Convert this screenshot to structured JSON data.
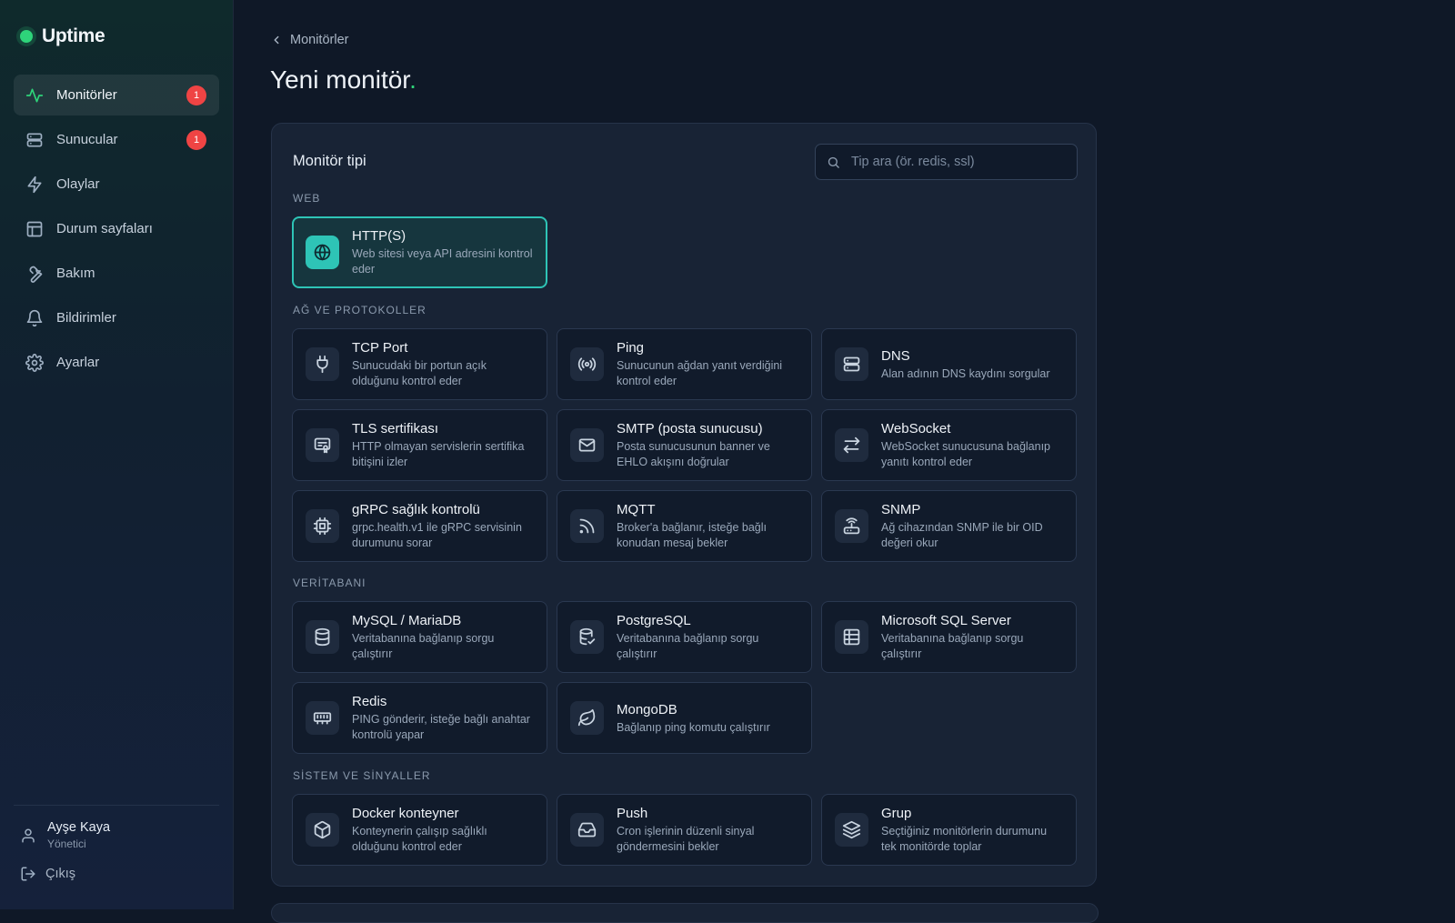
{
  "brand": {
    "name": "Uptime",
    "status_color": "#2ed47a"
  },
  "sidebar": {
    "items": [
      {
        "label": "Monitörler",
        "icon": "activity-icon",
        "badge": "1",
        "active": true
      },
      {
        "label": "Sunucular",
        "icon": "server-icon",
        "badge": "1"
      },
      {
        "label": "Olaylar",
        "icon": "zap-icon"
      },
      {
        "label": "Durum sayfaları",
        "icon": "layout-icon"
      },
      {
        "label": "Bakım",
        "icon": "wrench-icon"
      },
      {
        "label": "Bildirimler",
        "icon": "bell-icon"
      },
      {
        "label": "Ayarlar",
        "icon": "gear-icon"
      }
    ],
    "user": {
      "name": "Ayşe Kaya",
      "role": "Yönetici"
    },
    "logout_label": "Çıkış"
  },
  "header": {
    "breadcrumb": "Monitörler",
    "title": "Yeni monitör",
    "title_dot": "."
  },
  "panel": {
    "title": "Monitör tipi",
    "search_placeholder": "Tip ara (ör. redis, ssl)",
    "sections": [
      {
        "label": "WEB",
        "cards": [
          {
            "title": "HTTP(S)",
            "desc": "Web sitesi veya API adresini kontrol eder",
            "icon": "globe-icon",
            "selected": true
          }
        ]
      },
      {
        "label": "AĞ VE PROTOKOLLER",
        "cards": [
          {
            "title": "TCP Port",
            "desc": "Sunucudaki bir portun açık olduğunu kontrol eder",
            "icon": "plug-icon"
          },
          {
            "title": "Ping",
            "desc": "Sunucunun ağdan yanıt verdiğini kontrol eder",
            "icon": "radio-icon"
          },
          {
            "title": "DNS",
            "desc": "Alan adının DNS kaydını sorgular",
            "icon": "server-icon"
          },
          {
            "title": "TLS sertifikası",
            "desc": "HTTP olmayan servislerin sertifika bitişini izler",
            "icon": "certificate-icon"
          },
          {
            "title": "SMTP (posta sunucusu)",
            "desc": "Posta sunucusunun banner ve EHLO akışını doğrular",
            "icon": "mail-icon"
          },
          {
            "title": "WebSocket",
            "desc": "WebSocket sunucusuna bağlanıp yanıtı kontrol eder",
            "icon": "arrows-icon"
          },
          {
            "title": "gRPC sağlık kontrolü",
            "desc": "grpc.health.v1 ile gRPC servisinin durumunu sorar",
            "icon": "cpu-icon"
          },
          {
            "title": "MQTT",
            "desc": "Broker'a bağlanır, isteğe bağlı konudan mesaj bekler",
            "icon": "rss-icon"
          },
          {
            "title": "SNMP",
            "desc": "Ağ cihazından SNMP ile bir OID değeri okur",
            "icon": "router-icon"
          }
        ]
      },
      {
        "label": "VERİTABANI",
        "cards": [
          {
            "title": "MySQL / MariaDB",
            "desc": "Veritabanına bağlanıp sorgu çalıştırır",
            "icon": "database-icon"
          },
          {
            "title": "PostgreSQL",
            "desc": "Veritabanına bağlanıp sorgu çalıştırır",
            "icon": "database-check-icon"
          },
          {
            "title": "Microsoft SQL Server",
            "desc": "Veritabanına bağlanıp sorgu çalıştırır",
            "icon": "table-icon"
          },
          {
            "title": "Redis",
            "desc": "PING gönderir, isteğe bağlı anahtar kontrolü yapar",
            "icon": "memory-icon"
          },
          {
            "title": "MongoDB",
            "desc": "Bağlanıp ping komutu çalıştırır",
            "icon": "leaf-icon"
          }
        ]
      },
      {
        "label": "SİSTEM VE SİNYALLER",
        "cards": [
          {
            "title": "Docker konteyner",
            "desc": "Konteynerin çalışıp sağlıklı olduğunu kontrol eder",
            "icon": "box-icon"
          },
          {
            "title": "Push",
            "desc": "Cron işlerinin düzenli sinyal göndermesini bekler",
            "icon": "inbox-icon"
          },
          {
            "title": "Grup",
            "desc": "Seçtiğiniz monitörlerin durumunu tek monitörde toplar",
            "icon": "layers-icon"
          }
        ]
      }
    ]
  },
  "colors": {
    "accent": "#2ec4b6",
    "success": "#2ed47a",
    "badge": "#ef4444"
  }
}
